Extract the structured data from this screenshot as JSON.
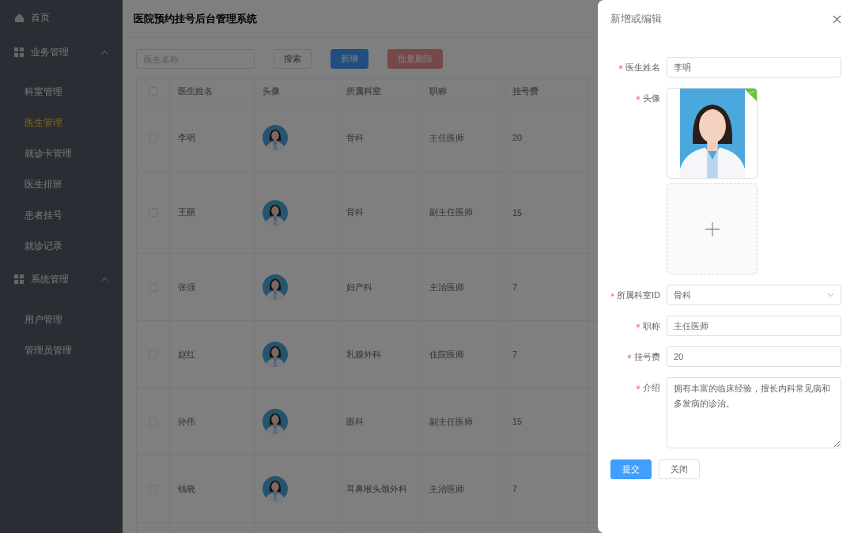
{
  "sidebar": {
    "items": [
      {
        "kind": "link",
        "label": "首页"
      },
      {
        "kind": "group",
        "label": "业务管理",
        "expanded": true,
        "children": [
          {
            "label": "科室管理",
            "selected": false
          },
          {
            "label": "医生管理",
            "selected": true
          },
          {
            "label": "就诊卡管理",
            "selected": false
          },
          {
            "label": "医生排班",
            "selected": false
          },
          {
            "label": "患者挂号",
            "selected": false
          },
          {
            "label": "就诊记录",
            "selected": false
          }
        ]
      },
      {
        "kind": "group",
        "label": "系统管理",
        "expanded": true,
        "children": [
          {
            "label": "用户管理",
            "selected": false
          },
          {
            "label": "管理员管理",
            "selected": false
          }
        ]
      }
    ]
  },
  "header": {
    "title": "医院预约挂号后台管理系统"
  },
  "toolbar": {
    "search": {
      "placeholder": "医生名称"
    },
    "buttons": [
      {
        "label": "搜索",
        "kind": "default",
        "disabled": false
      },
      {
        "label": "新增",
        "kind": "primary",
        "disabled": false
      },
      {
        "label": "批量删除",
        "kind": "danger",
        "disabled": true
      }
    ]
  },
  "table": {
    "all_checked": false,
    "columns": [
      "医生姓名",
      "头像",
      "所属科室",
      "职称",
      "挂号费"
    ],
    "rows": [
      {
        "checked": false,
        "name": "李明",
        "department": "骨科",
        "title": "主任医师",
        "fee": "20"
      },
      {
        "checked": false,
        "name": "王丽",
        "department": "骨科",
        "title": "副主任医师",
        "fee": "15"
      },
      {
        "checked": false,
        "name": "张强",
        "department": "妇产科",
        "title": "主治医师",
        "fee": "7"
      },
      {
        "checked": false,
        "name": "赵红",
        "department": "乳腺外科",
        "title": "住院医师",
        "fee": "7"
      },
      {
        "checked": false,
        "name": "孙伟",
        "department": "眼科",
        "title": "副主任医师",
        "fee": "15"
      },
      {
        "checked": false,
        "name": "钱晓",
        "department": "耳鼻喉头颈外科",
        "title": "主治医师",
        "fee": "7"
      }
    ]
  },
  "drawer": {
    "title": "新增或编辑",
    "fields": [
      {
        "kind": "text",
        "label": "医生姓名",
        "required": true,
        "value": "李明"
      },
      {
        "kind": "upload",
        "label": "头像",
        "required": true,
        "uploaded": true
      },
      {
        "kind": "select",
        "label": "所属科室ID",
        "required": true,
        "value": "骨科"
      },
      {
        "kind": "text",
        "label": "职称",
        "required": true,
        "value": "主任医师"
      },
      {
        "kind": "text",
        "label": "挂号费",
        "required": true,
        "value": "20"
      },
      {
        "kind": "textarea",
        "label": "介绍",
        "required": true,
        "value": "拥有丰富的临床经验，擅长内科常见病和多发病的诊治。"
      }
    ],
    "buttons": [
      {
        "label": "提交",
        "kind": "primary"
      },
      {
        "label": "关闭",
        "kind": "default"
      }
    ]
  }
}
